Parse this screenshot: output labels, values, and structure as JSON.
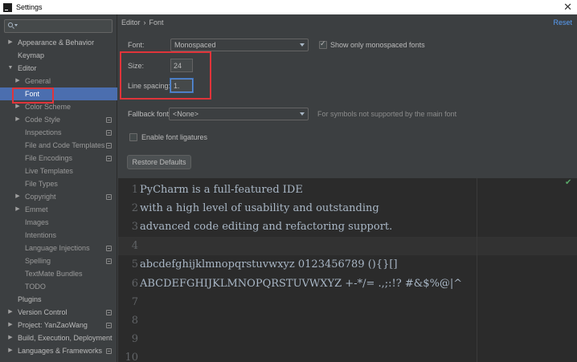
{
  "window": {
    "title": "Settings"
  },
  "sidebar": {
    "search": {
      "value": "",
      "placeholder": ""
    },
    "items": [
      {
        "label": "Appearance & Behavior",
        "arrow": "▶"
      },
      {
        "label": "Keymap",
        "arrow": ""
      },
      {
        "label": "Editor",
        "arrow": "▼"
      },
      {
        "label": "General",
        "arrow": "▶"
      },
      {
        "label": "Font",
        "arrow": ""
      },
      {
        "label": "Color Scheme",
        "arrow": "▶"
      },
      {
        "label": "Code Style",
        "arrow": "▶"
      },
      {
        "label": "Inspections",
        "arrow": ""
      },
      {
        "label": "File and Code Templates",
        "arrow": ""
      },
      {
        "label": "File Encodings",
        "arrow": ""
      },
      {
        "label": "Live Templates",
        "arrow": ""
      },
      {
        "label": "File Types",
        "arrow": ""
      },
      {
        "label": "Copyright",
        "arrow": "▶"
      },
      {
        "label": "Emmet",
        "arrow": "▶"
      },
      {
        "label": "Images",
        "arrow": ""
      },
      {
        "label": "Intentions",
        "arrow": ""
      },
      {
        "label": "Language Injections",
        "arrow": ""
      },
      {
        "label": "Spelling",
        "arrow": ""
      },
      {
        "label": "TextMate Bundles",
        "arrow": ""
      },
      {
        "label": "TODO",
        "arrow": ""
      },
      {
        "label": "Plugins",
        "arrow": ""
      },
      {
        "label": "Version Control",
        "arrow": "▶"
      },
      {
        "label": "Project: YanZaoWang",
        "arrow": "▶"
      },
      {
        "label": "Build, Execution, Deployment",
        "arrow": "▶"
      },
      {
        "label": "Languages & Frameworks",
        "arrow": "▶"
      }
    ],
    "selected": "Font"
  },
  "main": {
    "breadcrumb": {
      "parent": "Editor",
      "separator": "›",
      "current": "Font"
    },
    "reset_label": "Reset",
    "font": {
      "label": "Font:",
      "value": "Monospaced"
    },
    "show_only_monospaced": {
      "label": "Show only monospaced fonts",
      "checked": true
    },
    "size": {
      "label": "Size:",
      "value": "24"
    },
    "line_spacing": {
      "label": "Line spacing:",
      "value": "1."
    },
    "fallback_font": {
      "label": "Fallback font:",
      "value": "<None>",
      "hint": "For symbols not supported by the main font"
    },
    "ligatures": {
      "label": "Enable font ligatures",
      "checked": false
    },
    "restore_defaults_label": "Restore Defaults"
  },
  "preview": {
    "lines": [
      {
        "num": "1",
        "text": "PyCharm is a full-featured IDE"
      },
      {
        "num": "2",
        "text": "with a high level of usability and outstanding"
      },
      {
        "num": "3",
        "text": "advanced code editing and refactoring support."
      },
      {
        "num": "4",
        "text": ""
      },
      {
        "num": "5",
        "text": "abcdefghijklmnopqrstuvwxyz 0123456789 (){}[]"
      },
      {
        "num": "6",
        "text": "ABCDEFGHIJKLMNOPQRSTUVWXYZ +-*/= .,;:!? #&$%@|^"
      },
      {
        "num": "7",
        "text": ""
      },
      {
        "num": "8",
        "text": ""
      },
      {
        "num": "9",
        "text": ""
      },
      {
        "num": "10",
        "text": ""
      }
    ]
  },
  "colors": {
    "background": "#3c3f41",
    "selection": "#4b6eaf",
    "highlight_box": "#e0343a",
    "editor_background": "#2b2b2b",
    "link": "#589df6"
  },
  "icons": {
    "app": "pycharm-logo-icon",
    "close": "close-icon",
    "search": "search-icon",
    "project_scope": "project-scope-icon",
    "preview_status": "checkmark-icon"
  }
}
